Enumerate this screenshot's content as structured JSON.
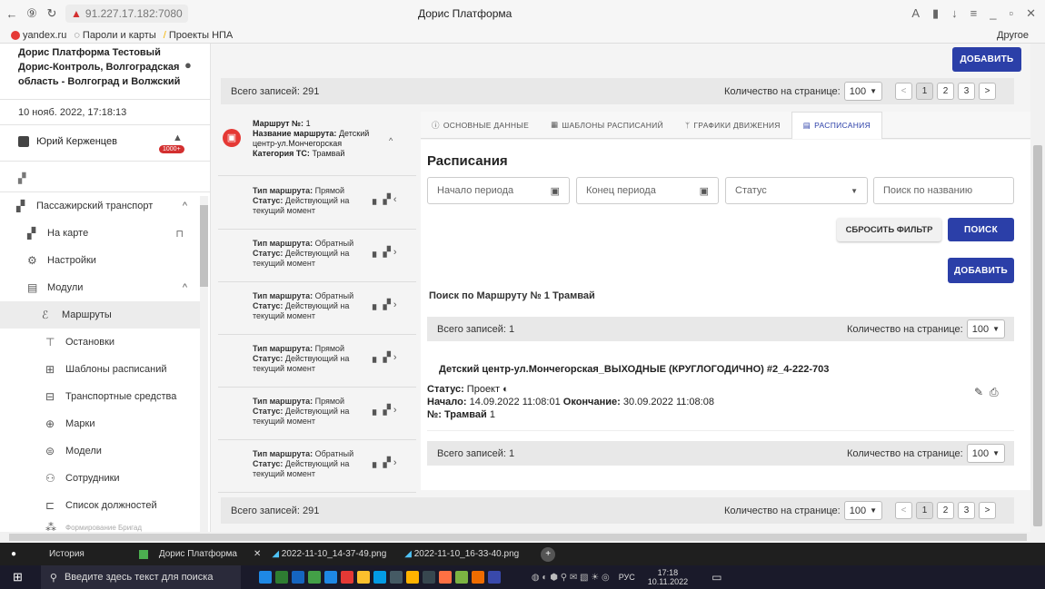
{
  "browser": {
    "url": "91.227.17.182:7080",
    "title": "Дорис Платформа",
    "bookmarks": [
      "yandex.ru",
      "Пароли и карты",
      "Проекты НПА"
    ],
    "other": "Другое"
  },
  "sidebar": {
    "org": "Дорис Платформа Тестовый Дорис-Контроль, Волгоградская область - Волгоград и Волжский",
    "datetime": "10 нояб. 2022, 17:18:13",
    "user": "Юрий Керженцев",
    "badge": "1000+",
    "items": [
      {
        "label": "Пассажирский транспорт",
        "icon": "bus-icon"
      },
      {
        "label": "На карте",
        "icon": "map-icon"
      },
      {
        "label": "Настройки",
        "icon": "gear-icon"
      },
      {
        "label": "Модули",
        "icon": "grid-icon"
      },
      {
        "label": "Маршруты",
        "icon": "route-icon"
      },
      {
        "label": "Остановки",
        "icon": "stop-icon"
      },
      {
        "label": "Шаблоны расписаний",
        "icon": "table-icon"
      },
      {
        "label": "Транспортные средства",
        "icon": "vehicle-icon"
      },
      {
        "label": "Марки",
        "icon": "brand-icon"
      },
      {
        "label": "Модели",
        "icon": "model-icon"
      },
      {
        "label": "Сотрудники",
        "icon": "person-icon"
      },
      {
        "label": "Список должностей",
        "icon": "briefcase-icon"
      },
      {
        "label": "Формирование Бригад",
        "icon": "team-icon"
      }
    ]
  },
  "toolbar": {
    "add": "ДОБАВИТЬ",
    "total": "Всего записей: 291",
    "per_page": "Количество на странице:",
    "per_page_val": "100",
    "pages": [
      "1",
      "2",
      "3"
    ]
  },
  "route_header": {
    "l1": "Маршрут №:",
    "v1": "1",
    "l2": "Название маршрута:",
    "v2": "Детский центр-ул.Мончегорская",
    "l3": "Категория ТС:",
    "v3": "Трамвай"
  },
  "route_items": [
    {
      "type": "Прямой",
      "status": "Действующий на текущий момент"
    },
    {
      "type": "Обратный",
      "status": "Действующий на текущий момент"
    },
    {
      "type": "Обратный",
      "status": "Действующий на текущий момент"
    },
    {
      "type": "Прямой",
      "status": "Действующий на текущий момент"
    },
    {
      "type": "Прямой",
      "status": "Действующий на текущий момент"
    },
    {
      "type": "Обратный",
      "status": "Действующий на текущий момент"
    }
  ],
  "labels": {
    "type": "Тип маршрута:",
    "status": "Статус:"
  },
  "tabs": [
    "ОСНОВНЫЕ ДАННЫЕ",
    "ШАБЛОНЫ РАСПИСАНИЙ",
    "ГРАФИКИ ДВИЖЕНИЯ",
    "РАСПИСАНИЯ"
  ],
  "panel": {
    "title": "Расписания",
    "start": "Начало периода",
    "end": "Конец периода",
    "status": "Статус",
    "search_ph": "Поиск по названию",
    "reset": "СБРОСИТЬ ФИЛЬТР",
    "search": "ПОИСК",
    "add": "ДОБАВИТЬ",
    "search_by": "Поиск по Маршруту № 1 Трамвай",
    "total": "Всего записей: 1",
    "per_page": "Количество на странице:",
    "per_page_val": "100",
    "card": {
      "name": "Детский центр-ул.Мончегорская_ВЫХОДНЫЕ (КРУГЛОГОДИЧНО) #2_4-222-703",
      "status_l": "Статус:",
      "status_v": "Проект",
      "start_l": "Начало:",
      "start_v": "14.09.2022 11:08:01",
      "end_l": "Окончание:",
      "end_v": "30.09.2022 11:08:08",
      "num_l": "№:",
      "num_v": "Трамвай",
      "num_n": "1"
    }
  },
  "taskbar": {
    "history": "История",
    "tab1": "Дорис Платформа",
    "tab2": "2022-11-10_14-37-49.png",
    "tab3": "2022-11-10_16-33-40.png"
  },
  "windows": {
    "search": "Введите здесь текст для поиска",
    "lang": "РУС",
    "time": "17:18",
    "date": "10.11.2022"
  }
}
